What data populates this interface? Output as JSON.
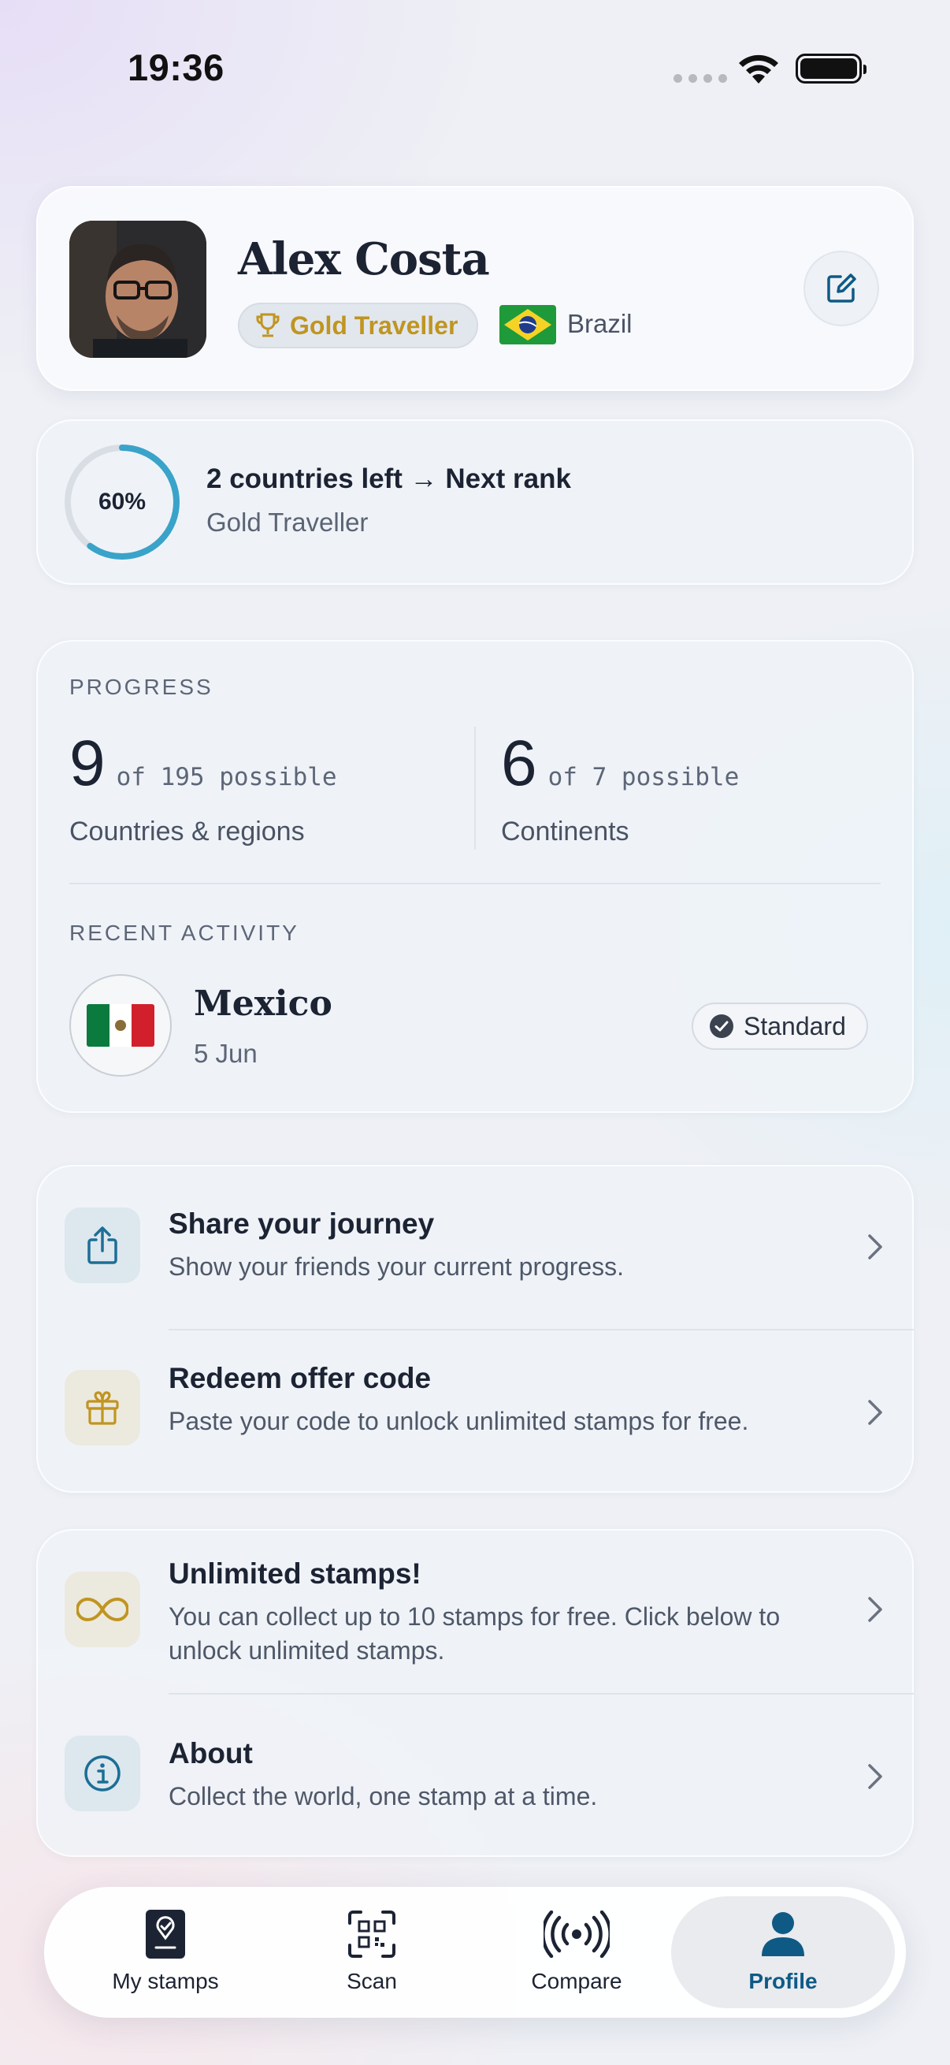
{
  "status_bar": {
    "time": "19:36"
  },
  "profile": {
    "name": "Alex Costa",
    "rank_badge": "Gold Traveller",
    "country": "Brazil",
    "edit_icon": "edit-icon"
  },
  "rank_progress": {
    "percent_label": "60%",
    "percent_value": 0.6,
    "title": "2 countries left → Next rank",
    "subtitle": "Gold Traveller"
  },
  "progress": {
    "section_label": "PROGRESS",
    "countries": {
      "value": "9",
      "suffix": "of 195 possible",
      "label": "Countries & regions"
    },
    "continents": {
      "value": "6",
      "suffix": "of 7 possible",
      "label": "Continents"
    }
  },
  "recent_activity": {
    "section_label": "RECENT ACTIVITY",
    "country": "Mexico",
    "date": "5 Jun",
    "badge": "Standard"
  },
  "actions": [
    {
      "title": "Share your journey",
      "subtitle": "Show your friends your current progress.",
      "icon": "share-icon"
    },
    {
      "title": "Redeem offer code",
      "subtitle": "Paste your code to unlock unlimited stamps for free.",
      "icon": "gift-icon"
    }
  ],
  "more": [
    {
      "title": "Unlimited stamps!",
      "subtitle": "You can collect up to 10 stamps for free. Click below to unlock unlimited stamps.",
      "icon": "infinity-icon"
    },
    {
      "title": "About",
      "subtitle": "Collect the world, one stamp at a time.",
      "icon": "info-icon"
    }
  ],
  "tabs": [
    {
      "label": "My stamps",
      "icon": "passport-icon"
    },
    {
      "label": "Scan",
      "icon": "qr-scan-icon"
    },
    {
      "label": "Compare",
      "icon": "broadcast-icon"
    },
    {
      "label": "Profile",
      "icon": "person-icon",
      "active": true
    }
  ],
  "colors": {
    "accent": "#0f5a85",
    "gold": "#c09520",
    "ring": "#3aa3c9"
  }
}
